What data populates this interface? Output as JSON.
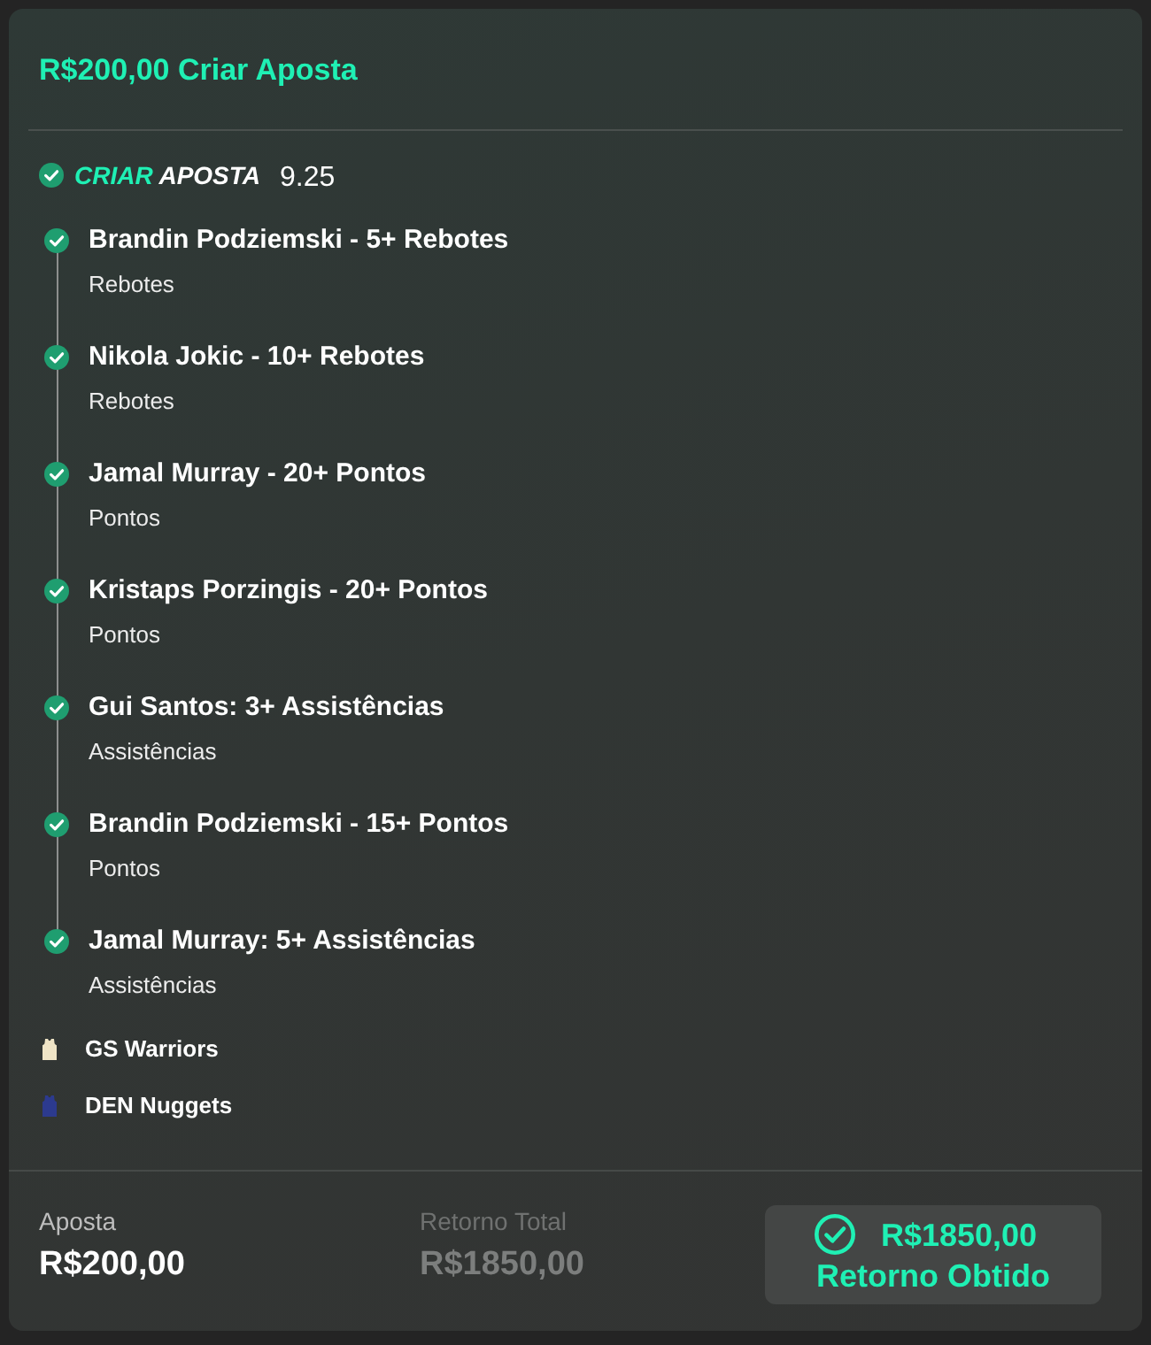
{
  "header": {
    "title": "R$200,00 Criar Aposta"
  },
  "bet_builder": {
    "word_1": "CRIAR",
    "word_2": "APOSTA",
    "odds": "9.25"
  },
  "selections": [
    {
      "title": "Brandin Podziemski - 5+ Rebotes",
      "market": "Rebotes",
      "won": true
    },
    {
      "title": "Nikola Jokic - 10+ Rebotes",
      "market": "Rebotes",
      "won": true
    },
    {
      "title": "Jamal Murray - 20+ Pontos",
      "market": "Pontos",
      "won": true
    },
    {
      "title": "Kristaps Porzingis - 20+ Pontos",
      "market": "Pontos",
      "won": true
    },
    {
      "title": "Gui Santos: 3+ Assistências",
      "market": "Assistências",
      "won": true
    },
    {
      "title": "Brandin Podziemski - 15+ Pontos",
      "market": "Pontos",
      "won": true
    },
    {
      "title": "Jamal Murray: 5+ Assistências",
      "market": "Assistências",
      "won": true
    }
  ],
  "teams": [
    {
      "name": "GS Warriors",
      "color": "#efe4c6"
    },
    {
      "name": "DEN Nuggets",
      "color": "#2c3a8e"
    }
  ],
  "footer": {
    "stake": {
      "label": "Aposta",
      "value": "R$200,00"
    },
    "total_return": {
      "label": "Retorno Total",
      "value": "R$1850,00"
    },
    "result": {
      "amount": "R$1850,00",
      "label": "Retorno Obtido"
    }
  }
}
